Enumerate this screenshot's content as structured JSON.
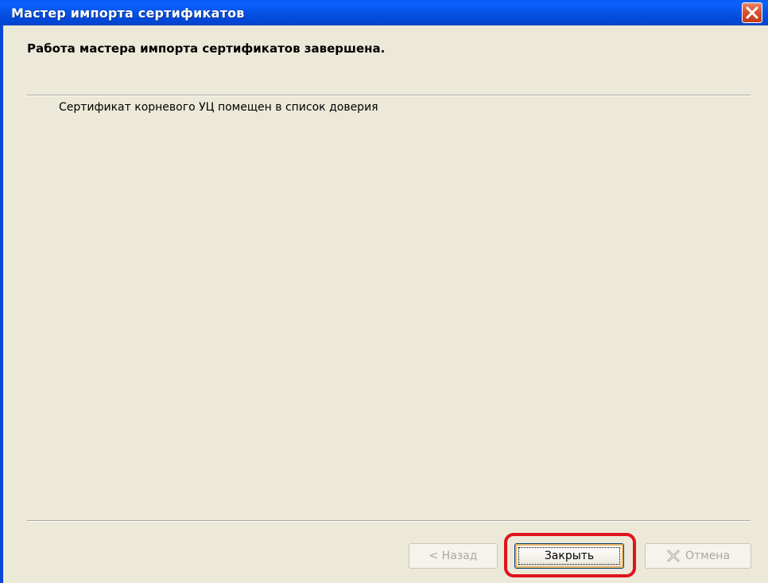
{
  "window": {
    "title": "Мастер импорта сертификатов"
  },
  "header": {
    "title": "Работа мастера импорта сертификатов завершена."
  },
  "body": {
    "message": "Сертификат корневого УЦ помещен в список доверия"
  },
  "buttons": {
    "back_label": "< Назад",
    "close_label": "Закрыть",
    "cancel_label": "Отмена"
  },
  "icons": {
    "window_close": "close-icon",
    "cancel": "cancel-x-icon"
  },
  "colors": {
    "titlebar": "#0553e4",
    "client_bg": "#ece9d8",
    "close_button": "#d8532f",
    "highlight": "#e0141e",
    "disabled_text": "#aca899"
  }
}
